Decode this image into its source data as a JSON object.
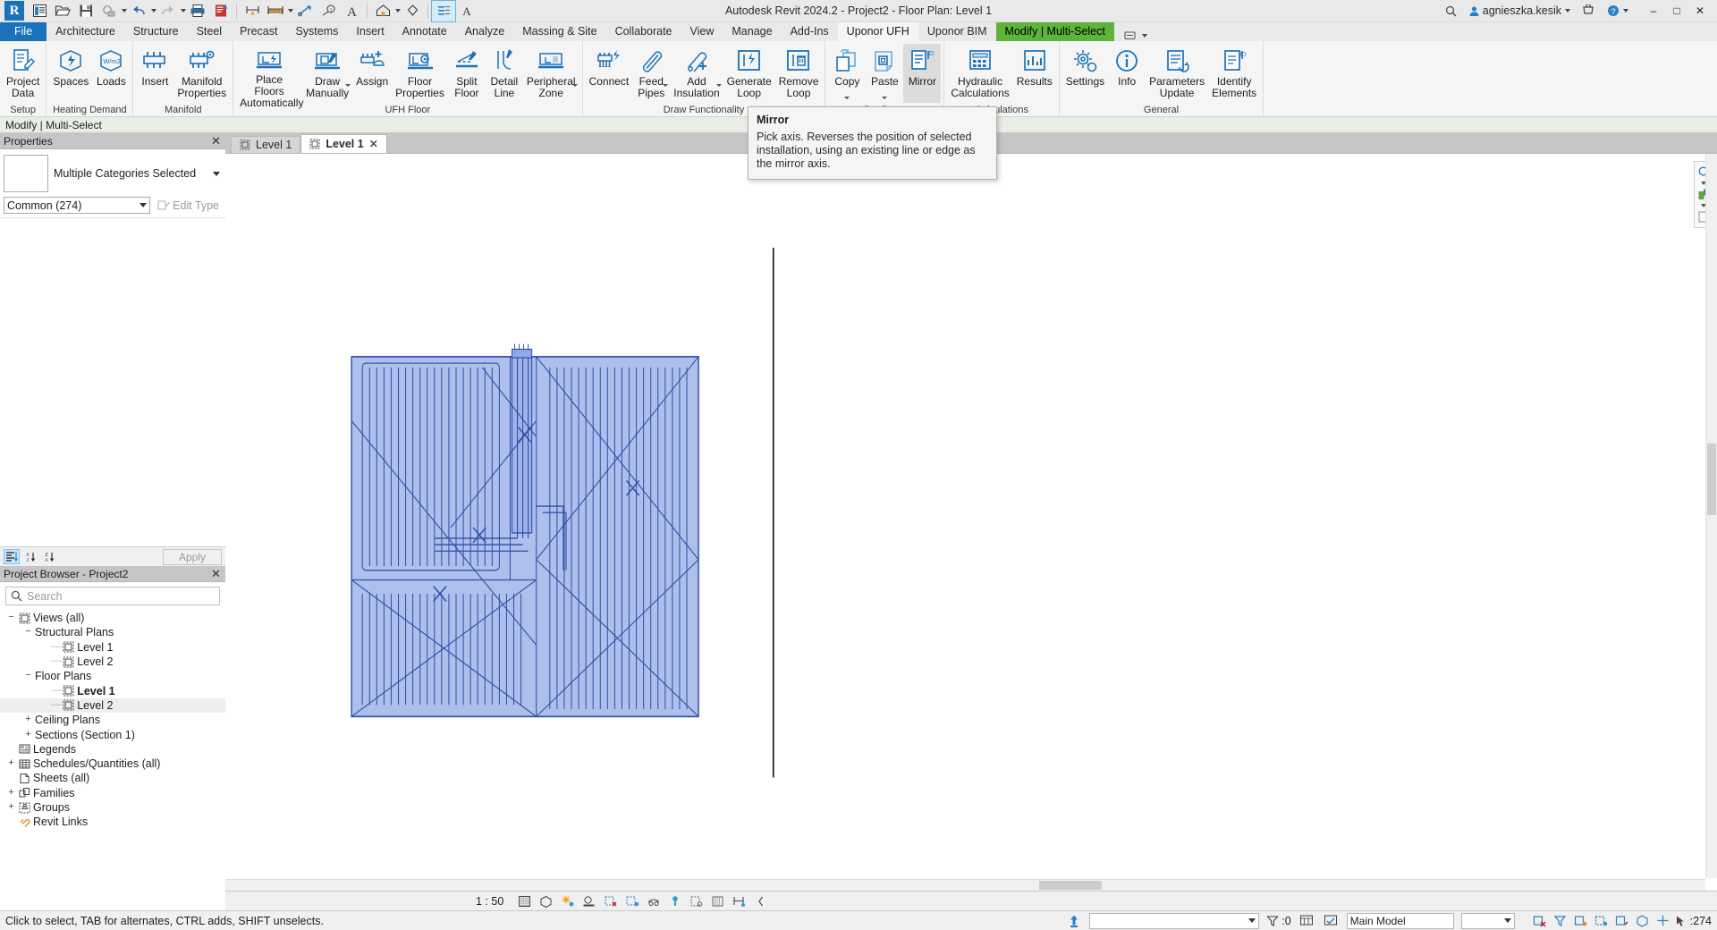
{
  "titlebar": {
    "app_title": "Autodesk Revit 2024.2 - Project2 - Floor Plan: Level 1",
    "logo_letter": "R",
    "quick_access": [
      {
        "name": "open-file-icon",
        "label": "Open"
      },
      {
        "name": "save-icon",
        "label": "Save"
      },
      {
        "name": "sync-with-central-icon",
        "label": "Synchronize"
      },
      {
        "name": "undo-icon",
        "label": "Undo"
      },
      {
        "name": "redo-icon",
        "label": "Redo"
      },
      {
        "name": "print-icon",
        "label": "Print"
      },
      {
        "name": "new-sheet-icon",
        "label": "New Sheet"
      },
      {
        "name": "measure-icon",
        "label": "Measure"
      },
      {
        "name": "aligned-dimension-icon",
        "label": "Aligned Dimension"
      },
      {
        "name": "tag-icon",
        "label": "Tag"
      },
      {
        "name": "keynote-icon",
        "label": "Keynote"
      },
      {
        "name": "text-icon",
        "label": "Text"
      },
      {
        "name": "default-3d-view-icon",
        "label": "Default 3D View"
      },
      {
        "name": "section-icon",
        "label": "Section"
      },
      {
        "name": "thin-lines-icon",
        "label": "Thin Lines"
      }
    ],
    "user_name": "agnieszka.kesik",
    "help_label": "?",
    "window_minimize": "–",
    "window_maximize": "□",
    "window_close": "✕"
  },
  "tabs": [
    {
      "label": "File",
      "state": "file"
    },
    {
      "label": "Architecture",
      "state": "normal"
    },
    {
      "label": "Structure",
      "state": "normal"
    },
    {
      "label": "Steel",
      "state": "normal"
    },
    {
      "label": "Precast",
      "state": "normal"
    },
    {
      "label": "Systems",
      "state": "normal"
    },
    {
      "label": "Insert",
      "state": "normal"
    },
    {
      "label": "Annotate",
      "state": "normal"
    },
    {
      "label": "Analyze",
      "state": "normal"
    },
    {
      "label": "Massing & Site",
      "state": "normal"
    },
    {
      "label": "Collaborate",
      "state": "normal"
    },
    {
      "label": "View",
      "state": "normal"
    },
    {
      "label": "Manage",
      "state": "normal"
    },
    {
      "label": "Add-Ins",
      "state": "normal"
    },
    {
      "label": "Uponor UFH",
      "state": "active"
    },
    {
      "label": "Uponor BIM",
      "state": "normal"
    },
    {
      "label": "Modify | Multi-Select",
      "state": "modify"
    }
  ],
  "ribbon": {
    "panels": [
      {
        "title": "Setup",
        "buttons": [
          {
            "label": "Project\nData",
            "icon": "project-data-icon",
            "dropdown": false
          }
        ]
      },
      {
        "title": "Heating Demand",
        "buttons": [
          {
            "label": "Spaces",
            "icon": "spaces-icon",
            "dropdown": false
          },
          {
            "label": "Loads",
            "icon": "loads-icon",
            "dropdown": false
          }
        ]
      },
      {
        "title": "Manifold",
        "buttons": [
          {
            "label": "Insert",
            "icon": "insert-manifold-icon",
            "dropdown": false
          },
          {
            "label": "Manifold\nProperties",
            "icon": "manifold-properties-icon",
            "dropdown": false
          }
        ]
      },
      {
        "title": "UFH Floor",
        "buttons": [
          {
            "label": "Place Floors\nAutomatically",
            "icon": "place-floors-icon",
            "dropdown": false
          },
          {
            "label": "Draw\nManually",
            "icon": "draw-manually-icon",
            "dropdown": true
          },
          {
            "label": "Assign",
            "icon": "assign-icon",
            "dropdown": false
          },
          {
            "label": "Floor\nProperties",
            "icon": "floor-properties-icon",
            "dropdown": false
          },
          {
            "label": "Split\nFloor",
            "icon": "split-floor-icon",
            "dropdown": false
          },
          {
            "label": "Detail\nLine",
            "icon": "detail-line-icon",
            "dropdown": false
          },
          {
            "label": "Peripheral\nZone",
            "icon": "peripheral-zone-icon",
            "dropdown": true
          }
        ]
      },
      {
        "title": "Draw Functionality",
        "buttons": [
          {
            "label": "Connect",
            "icon": "connect-icon",
            "dropdown": false
          },
          {
            "label": "Feed\nPipes",
            "icon": "feed-pipes-icon",
            "dropdown": true
          },
          {
            "label": "Add\nInsulation",
            "icon": "add-insulation-icon",
            "dropdown": true
          },
          {
            "label": "Generate\nLoop",
            "icon": "generate-loop-icon",
            "dropdown": false
          },
          {
            "label": "Remove\nLoop",
            "icon": "remove-loop-icon",
            "dropdown": false
          }
        ]
      },
      {
        "title": "Duplicate",
        "buttons": [
          {
            "label": "Copy",
            "icon": "copy-icon",
            "dropdown": true
          },
          {
            "label": "Paste",
            "icon": "paste-icon",
            "dropdown": true
          },
          {
            "label": "Mirror",
            "icon": "mirror-icon",
            "dropdown": false,
            "hovered": true
          }
        ]
      },
      {
        "title": "Calculations",
        "buttons": [
          {
            "label": "Hydraulic\nCalculations",
            "icon": "hydraulic-calculations-icon",
            "dropdown": false
          },
          {
            "label": "Results",
            "icon": "results-icon",
            "dropdown": false
          }
        ]
      },
      {
        "title": "General",
        "buttons": [
          {
            "label": "Settings",
            "icon": "settings-icon",
            "dropdown": false
          },
          {
            "label": "Info",
            "icon": "info-icon",
            "dropdown": false
          },
          {
            "label": "Parameters\nUpdate",
            "icon": "parameters-update-icon",
            "dropdown": false
          },
          {
            "label": "Identify\nElements",
            "icon": "identify-elements-icon",
            "dropdown": false
          }
        ]
      }
    ]
  },
  "tooltip": {
    "title": "Mirror",
    "body": "Pick axis. Reverses the position of selected installation, using an existing line or edge as the mirror axis."
  },
  "options_bar": {
    "text": "Modify | Multi-Select"
  },
  "properties": {
    "panel_title": "Properties",
    "selection_label": "Multiple Categories Selected",
    "type_selector": "Common (274)",
    "edit_type_label": "Edit Type",
    "apply_label": "Apply",
    "close_glyph": "✕"
  },
  "project_browser": {
    "panel_title": "Project Browser - Project2",
    "search_placeholder": "Search",
    "search_value": "",
    "close_glyph": "✕",
    "tree": [
      {
        "label": "Views (all)",
        "indent": 0,
        "expander": "−",
        "icon": "views-icon",
        "bold": false,
        "selected": false,
        "dashes": ""
      },
      {
        "label": "Structural Plans",
        "indent": 1,
        "expander": "−",
        "icon": "",
        "bold": false,
        "selected": false,
        "dashes": ""
      },
      {
        "label": "Level 1",
        "indent": 2,
        "expander": "",
        "icon": "plan-view-icon",
        "bold": false,
        "selected": false,
        "dashes": "——"
      },
      {
        "label": "Level 2",
        "indent": 2,
        "expander": "",
        "icon": "plan-view-icon",
        "bold": false,
        "selected": false,
        "dashes": "——"
      },
      {
        "label": "Floor Plans",
        "indent": 1,
        "expander": "−",
        "icon": "",
        "bold": false,
        "selected": false,
        "dashes": ""
      },
      {
        "label": "Level 1",
        "indent": 2,
        "expander": "",
        "icon": "plan-view-icon",
        "bold": true,
        "selected": false,
        "dashes": "——"
      },
      {
        "label": "Level 2",
        "indent": 2,
        "expander": "",
        "icon": "plan-view-icon",
        "bold": false,
        "selected": true,
        "dashes": "——"
      },
      {
        "label": "Ceiling Plans",
        "indent": 1,
        "expander": "+",
        "icon": "",
        "bold": false,
        "selected": false,
        "dashes": ""
      },
      {
        "label": "Sections (Section 1)",
        "indent": 1,
        "expander": "+",
        "icon": "",
        "bold": false,
        "selected": false,
        "dashes": ""
      },
      {
        "label": "Legends",
        "indent": 0,
        "expander": "",
        "icon": "legends-icon",
        "bold": false,
        "selected": false,
        "dashes": ""
      },
      {
        "label": "Schedules/Quantities (all)",
        "indent": 0,
        "expander": "+",
        "icon": "schedules-icon",
        "bold": false,
        "selected": false,
        "dashes": ""
      },
      {
        "label": "Sheets (all)",
        "indent": 0,
        "expander": "",
        "icon": "sheets-icon",
        "bold": false,
        "selected": false,
        "dashes": ""
      },
      {
        "label": "Families",
        "indent": 0,
        "expander": "+",
        "icon": "families-icon",
        "bold": false,
        "selected": false,
        "dashes": ""
      },
      {
        "label": "Groups",
        "indent": 0,
        "expander": "+",
        "icon": "groups-icon",
        "bold": false,
        "selected": false,
        "dashes": ""
      },
      {
        "label": "Revit Links",
        "indent": 0,
        "expander": "",
        "icon": "revit-links-icon",
        "bold": false,
        "selected": false,
        "dashes": ""
      }
    ]
  },
  "view_tabs": [
    {
      "label": "Level 1",
      "active": false,
      "closable": false
    },
    {
      "label": "Level 1",
      "active": true,
      "closable": true
    }
  ],
  "view_bar": {
    "scale": "1 : 50",
    "icons": [
      {
        "name": "detail-level-icon"
      },
      {
        "name": "visual-style-icon"
      },
      {
        "name": "sun-path-icon"
      },
      {
        "name": "shadows-icon"
      },
      {
        "name": "render-dialog-icon"
      },
      {
        "name": "crop-view-icon"
      },
      {
        "name": "show-crop-region-icon"
      },
      {
        "name": "lock-3d-view-icon"
      },
      {
        "name": "temporary-hide-isolate-icon"
      },
      {
        "name": "reveal-hidden-elements-icon"
      },
      {
        "name": "temporary-view-properties-icon"
      },
      {
        "name": "analytical-model-icon"
      },
      {
        "name": "expand-view-bar-icon"
      }
    ]
  },
  "status_bar": {
    "hint_text": "Click to select, TAB for alternates, CTRL adds, SHIFT unselects.",
    "press_select_icon": "press-select-icon",
    "filter_count": ":0",
    "main_model_label": "Main Model",
    "worksets_icon": "worksets-icon",
    "design_options_icon": "design-options-icon",
    "selection_count": ":274",
    "right_icons": [
      {
        "name": "exclude-options-icon"
      },
      {
        "name": "filter-selection-icon"
      },
      {
        "name": "select-links-icon"
      },
      {
        "name": "select-underlay-icon"
      },
      {
        "name": "select-pinned-icon"
      },
      {
        "name": "select-by-face-icon"
      },
      {
        "name": "drag-elements-icon"
      }
    ]
  },
  "colors": {
    "revit_blue": "#1a72ba",
    "modify_green": "#5eb43a",
    "selection_fill": "#8fa8e8",
    "selection_stroke": "#2f4fa8",
    "ribbon_bg": "#f5f5f5",
    "chrome_bg": "#e9e9e9",
    "options_bar_bg": "#e8eee4"
  }
}
